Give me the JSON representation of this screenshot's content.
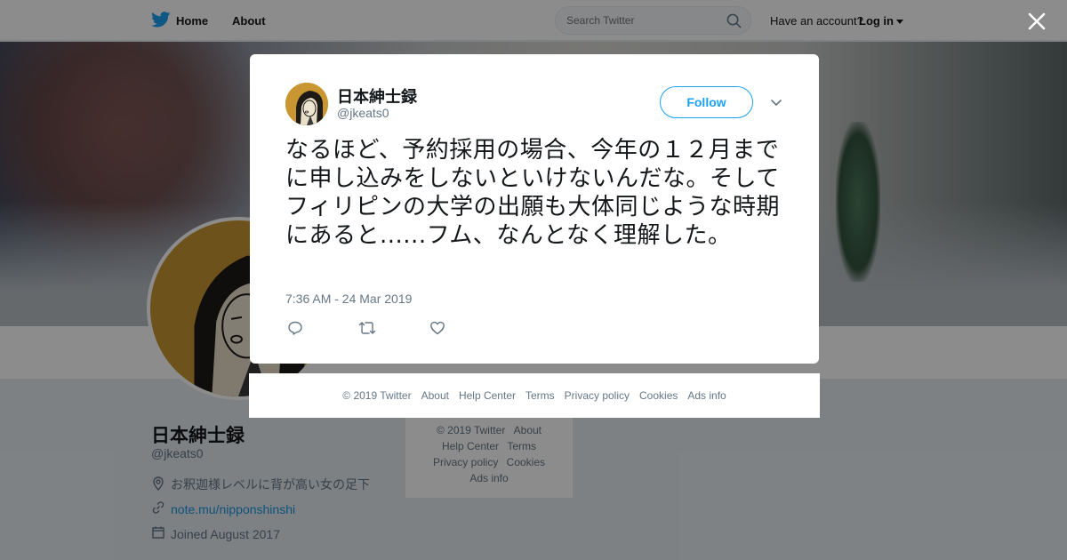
{
  "topnav": {
    "home_label": "Home",
    "about_label": "About",
    "search_placeholder": "Search Twitter",
    "account_prompt": "Have an account?",
    "login_label": "Log in"
  },
  "profile": {
    "name": "日本紳士録",
    "handle": "@jkeats0",
    "location": "お釈迦様レベルに背が高い女の足下",
    "url": "note.mu/nipponshinshi",
    "joined": "Joined August 2017"
  },
  "page_footer": {
    "links": [
      "© 2019 Twitter",
      "About",
      "Help Center",
      "Terms",
      "Privacy policy",
      "Cookies",
      "Ads info"
    ]
  },
  "tweet": {
    "author_name": "日本紳士録",
    "author_handle": "@jkeats0",
    "follow_label": "Follow",
    "text": "なるほど、予約採用の場合、今年の１２月までに申し込みをしないといけないんだな。そしてフィリピンの大学の出願も大体同じような時期にあると......フム、なんとなく理解した。",
    "timestamp": "7:36 AM - 24 Mar 2019"
  },
  "modal_footer": {
    "links": [
      "© 2019 Twitter",
      "About",
      "Help Center",
      "Terms",
      "Privacy policy",
      "Cookies",
      "Ads info"
    ]
  },
  "icons": {
    "brand": "twitter-bird-icon",
    "search": "search-icon",
    "close": "close-icon",
    "caret": "chevron-down-icon",
    "reply": "reply-icon",
    "retweet": "retweet-icon",
    "like": "heart-icon",
    "location": "location-pin-icon",
    "link": "link-icon",
    "calendar": "calendar-icon"
  },
  "colors": {
    "brand_blue": "#1da1f2",
    "link_blue": "#1b95e0",
    "muted_text": "#657786",
    "avatar_gold": "#c99632"
  }
}
